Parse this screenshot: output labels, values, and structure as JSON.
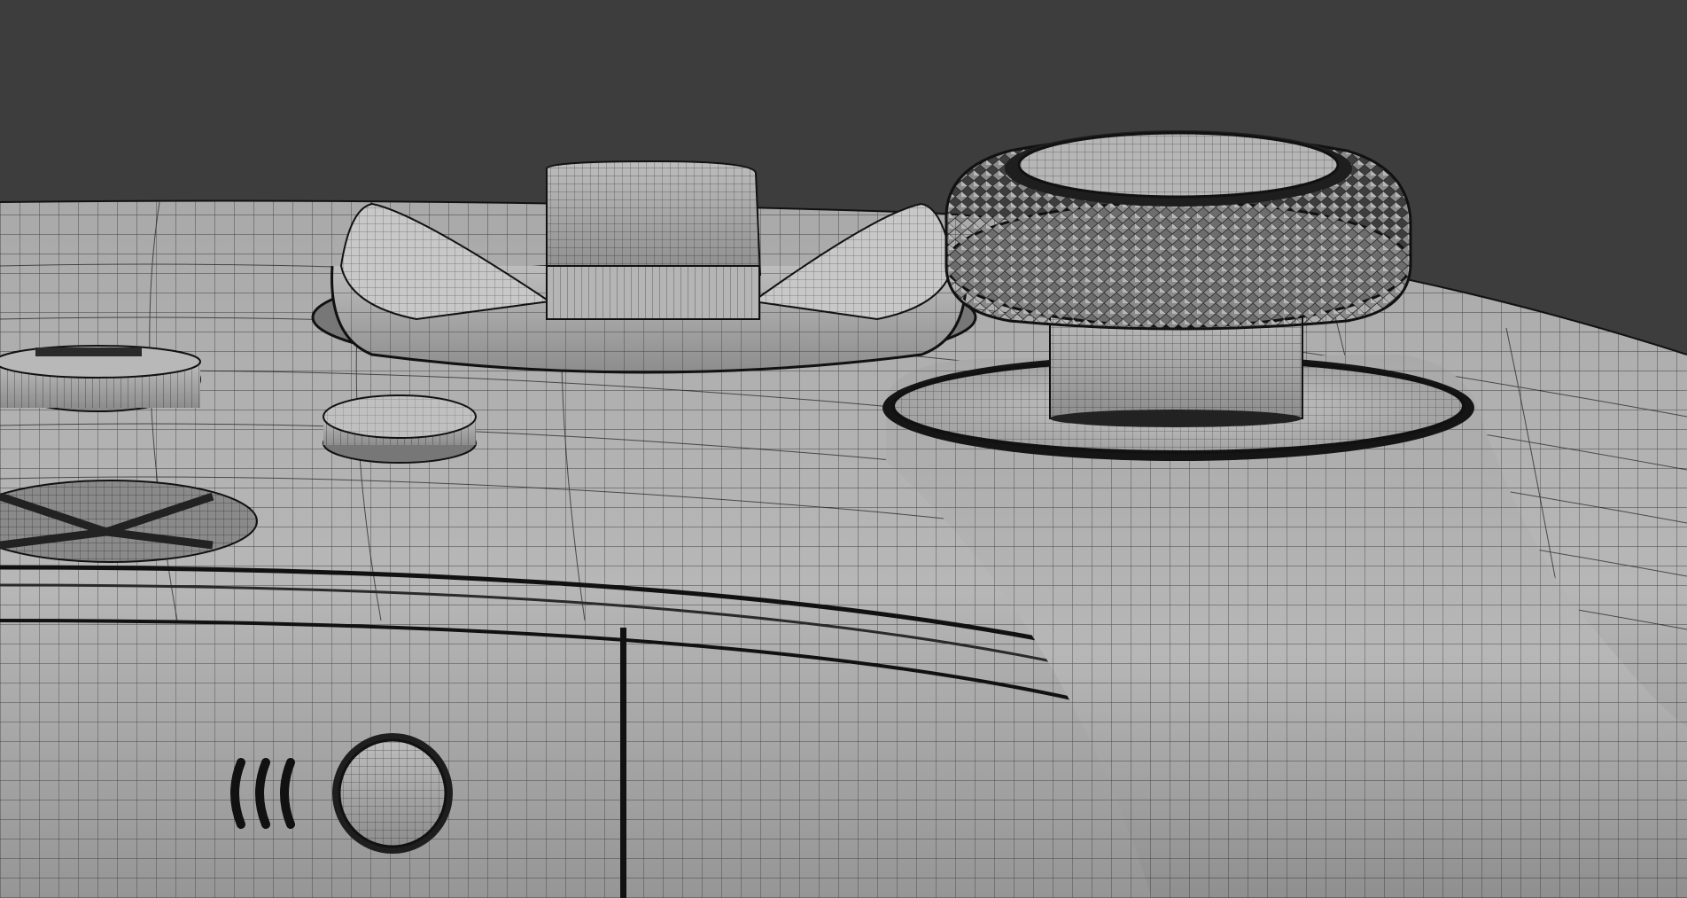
{
  "viewport": {
    "background_color": "#3d3d3d",
    "shading": "wireframe-on-solid"
  },
  "model": {
    "subject": "game-controller-closeup",
    "surface_color": "#9e9e9e",
    "wire_color": "#1a1a1a",
    "parts": [
      "controller-body",
      "home-button",
      "view-button",
      "menu-button",
      "d-pad",
      "thumbstick",
      "thumbstick-well",
      "usb-port",
      "share-button",
      "grip-seam"
    ]
  }
}
